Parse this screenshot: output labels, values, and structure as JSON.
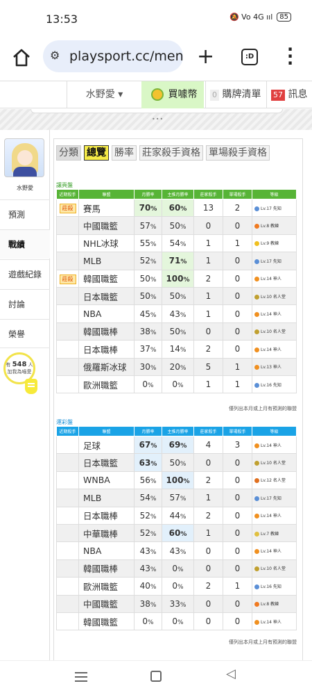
{
  "status_bar": {
    "time": "13:53",
    "icons": "🔕 Vo 4G ııl",
    "battery": "85"
  },
  "browser": {
    "url": "playsport.cc/men",
    "tabs_count": ":D"
  },
  "top_nav": {
    "user": "水野愛 ▾",
    "coin_label": "買噱幣",
    "list_count": "0",
    "list_label": "購牌清單",
    "msg_count": "57",
    "msg_label": "訊息"
  },
  "stripe_dots": "•••",
  "sidebar": {
    "username": "水野愛",
    "items": [
      {
        "label": "預測"
      },
      {
        "label": "戰績"
      },
      {
        "label": "遊戲紀錄"
      },
      {
        "label": "討論"
      },
      {
        "label": "榮譽"
      }
    ],
    "fans": {
      "prefix": "有",
      "count": "548",
      "suffix": "人",
      "line2": "加我為喵愛"
    }
  },
  "tabs": [
    {
      "label": "分類"
    },
    {
      "label": "總覽"
    },
    {
      "label": "勝率"
    },
    {
      "label": "莊家殺手資格"
    },
    {
      "label": "單場殺手資格"
    }
  ],
  "columns": [
    "近期殺手",
    "聯盟",
    "月勝率",
    "主推月勝率",
    "莊家殺手",
    "單場殺手",
    "等級"
  ],
  "section1": {
    "title": "讓⾴盤",
    "rows": [
      {
        "badge": "莊殺",
        "league": "賽馬",
        "month": "70",
        "main": "60",
        "banker": "13",
        "single": "2",
        "level": "Lv.17 先知",
        "lvc": "#5b8fd6"
      },
      {
        "badge": "",
        "league": "中國職籃",
        "month": "57",
        "main": "50",
        "banker": "0",
        "single": "0",
        "level": "Lv.8 教練",
        "lvc": "#f07a20"
      },
      {
        "badge": "",
        "league": "NHL冰球",
        "month": "55",
        "main": "54",
        "banker": "1",
        "single": "1",
        "level": "Lv.9 教練",
        "lvc": "#f0c020"
      },
      {
        "badge": "",
        "league": "MLB",
        "month": "52",
        "main": "71",
        "banker": "1",
        "single": "0",
        "level": "Lv.17 先知",
        "lvc": "#5b8fd6"
      },
      {
        "badge": "莊殺",
        "league": "韓國職籃",
        "month": "50",
        "main": "100",
        "banker": "2",
        "single": "0",
        "level": "Lv.14 神人",
        "lvc": "#f09020"
      },
      {
        "badge": "",
        "league": "日本職籃",
        "month": "50",
        "main": "50",
        "banker": "1",
        "single": "0",
        "level": "Lv.10 名人堂",
        "lvc": "#c0a030"
      },
      {
        "badge": "",
        "league": "NBA",
        "month": "45",
        "main": "43",
        "banker": "1",
        "single": "0",
        "level": "Lv.14 神人",
        "lvc": "#f09020"
      },
      {
        "badge": "",
        "league": "韓國職棒",
        "month": "38",
        "main": "50",
        "banker": "0",
        "single": "0",
        "level": "Lv.10 名人堂",
        "lvc": "#c0a030"
      },
      {
        "badge": "",
        "league": "日本職棒",
        "month": "37",
        "main": "14",
        "banker": "2",
        "single": "0",
        "level": "Lv.14 神人",
        "lvc": "#f09020"
      },
      {
        "badge": "",
        "league": "俄羅斯冰球",
        "month": "30",
        "main": "20",
        "banker": "5",
        "single": "1",
        "level": "Lv.13 神人",
        "lvc": "#f09020"
      },
      {
        "badge": "",
        "league": "歐洲職籃",
        "month": "0",
        "main": "0",
        "banker": "1",
        "single": "1",
        "level": "Lv.16 先知",
        "lvc": "#5b8fd6"
      }
    ],
    "note": "僅列出本月或上月有預測的聯盟"
  },
  "section2": {
    "title": "運彩盤",
    "rows": [
      {
        "league": "足球",
        "month": "67",
        "main": "69",
        "banker": "4",
        "single": "3",
        "level": "Lv.14 神人",
        "lvc": "#f09020"
      },
      {
        "league": "日本職籃",
        "month": "63",
        "main": "50",
        "banker": "0",
        "single": "0",
        "level": "Lv.10 名人堂",
        "lvc": "#c0a030"
      },
      {
        "league": "WNBA",
        "month": "56",
        "main": "100",
        "banker": "2",
        "single": "0",
        "level": "Lv.12 名人堂",
        "lvc": "#e07020"
      },
      {
        "league": "MLB",
        "month": "54",
        "main": "57",
        "banker": "1",
        "single": "0",
        "level": "Lv.17 先知",
        "lvc": "#5b8fd6"
      },
      {
        "league": "日本職棒",
        "month": "52",
        "main": "44",
        "banker": "2",
        "single": "0",
        "level": "Lv.14 神人",
        "lvc": "#f09020"
      },
      {
        "league": "中華職棒",
        "month": "52",
        "main": "60",
        "banker": "1",
        "single": "0",
        "level": "Lv.7 教練",
        "lvc": "#e0c040"
      },
      {
        "league": "NBA",
        "month": "43",
        "main": "43",
        "banker": "0",
        "single": "0",
        "level": "Lv.14 神人",
        "lvc": "#f09020"
      },
      {
        "league": "韓國職棒",
        "month": "43",
        "main": "0",
        "banker": "0",
        "single": "0",
        "level": "Lv.10 名人堂",
        "lvc": "#c0a030"
      },
      {
        "league": "歐洲職籃",
        "month": "40",
        "main": "0",
        "banker": "2",
        "single": "1",
        "level": "Lv.16 先知",
        "lvc": "#5b8fd6"
      },
      {
        "league": "中國職籃",
        "month": "38",
        "main": "33",
        "banker": "0",
        "single": "0",
        "level": "Lv.8 教練",
        "lvc": "#f07a20"
      },
      {
        "league": "韓國職籃",
        "month": "0",
        "main": "0",
        "banker": "0",
        "single": "0",
        "level": "Lv.14 神人",
        "lvc": "#f09020"
      }
    ],
    "note": "僅列出本月或上月有預測的聯盟"
  },
  "colors": {
    "green_header": "#57b436",
    "blue_header": "#1aa3e6",
    "highlight_green": "#e4f6dc",
    "highlight_blue": "#e2f0fb",
    "active_tab": "#f7ec47"
  },
  "icons": [
    "home-icon",
    "tune-icon",
    "plus-icon",
    "tabs-icon",
    "more-vert-icon",
    "coin-icon",
    "bulb-icon",
    "recent-apps-icon",
    "home-nav-icon",
    "back-icon"
  ]
}
